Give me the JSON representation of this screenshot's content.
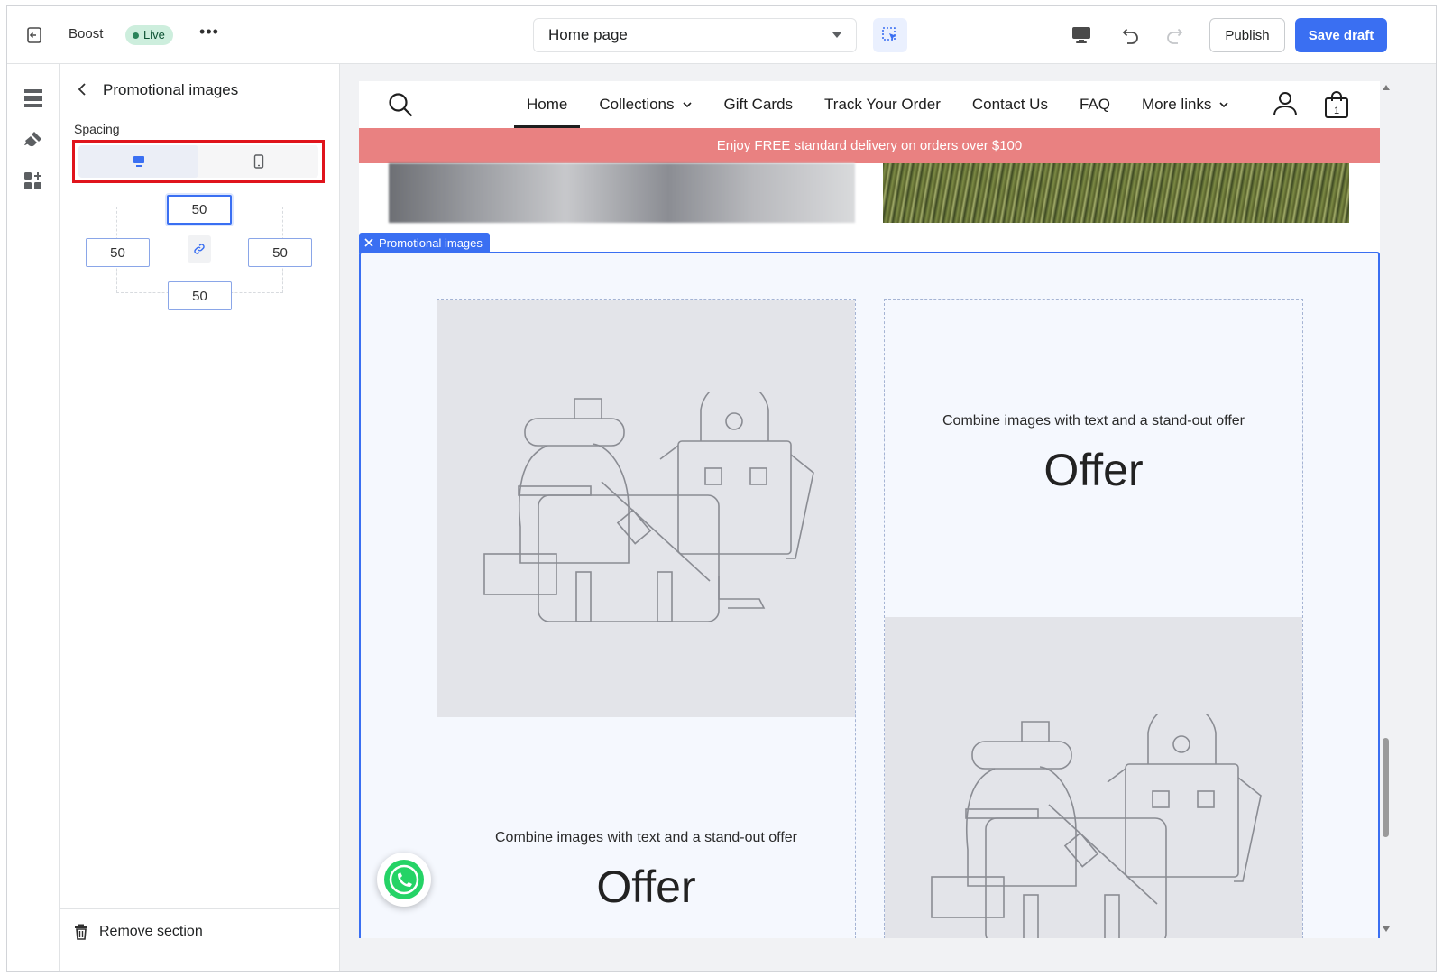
{
  "topbar": {
    "app_name": "Boost",
    "status_badge": "Live",
    "more_label": "•••",
    "page_select": "Home page",
    "publish_label": "Publish",
    "save_label": "Save draft"
  },
  "panel": {
    "title": "Promotional images",
    "spacing_label": "Spacing",
    "spacing": {
      "top": "50",
      "left": "50",
      "right": "50",
      "bottom": "50"
    },
    "remove_label": "Remove section"
  },
  "store": {
    "nav": [
      {
        "label": "Home",
        "active": true,
        "dropdown": false
      },
      {
        "label": "Collections",
        "dropdown": true
      },
      {
        "label": "Gift Cards",
        "dropdown": false
      },
      {
        "label": "Track Your Order",
        "dropdown": false
      },
      {
        "label": "Contact Us",
        "dropdown": false
      },
      {
        "label": "FAQ",
        "dropdown": false
      },
      {
        "label": "More links",
        "dropdown": true
      }
    ],
    "cart_count": "1",
    "announcement": "Enjoy FREE standard delivery on orders over $100",
    "announcement_color": "#e98181"
  },
  "section": {
    "tag_label": "Promotional images",
    "cards": [
      {
        "subtitle": "Combine images with text and a stand-out offer",
        "heading": "Offer"
      },
      {
        "subtitle": "Combine images with text and a stand-out offer",
        "heading": "Offer"
      }
    ]
  },
  "colors": {
    "accent": "#3a6ff2",
    "highlight_box": "#e0141c",
    "live_badge_bg": "#cdeedd"
  }
}
